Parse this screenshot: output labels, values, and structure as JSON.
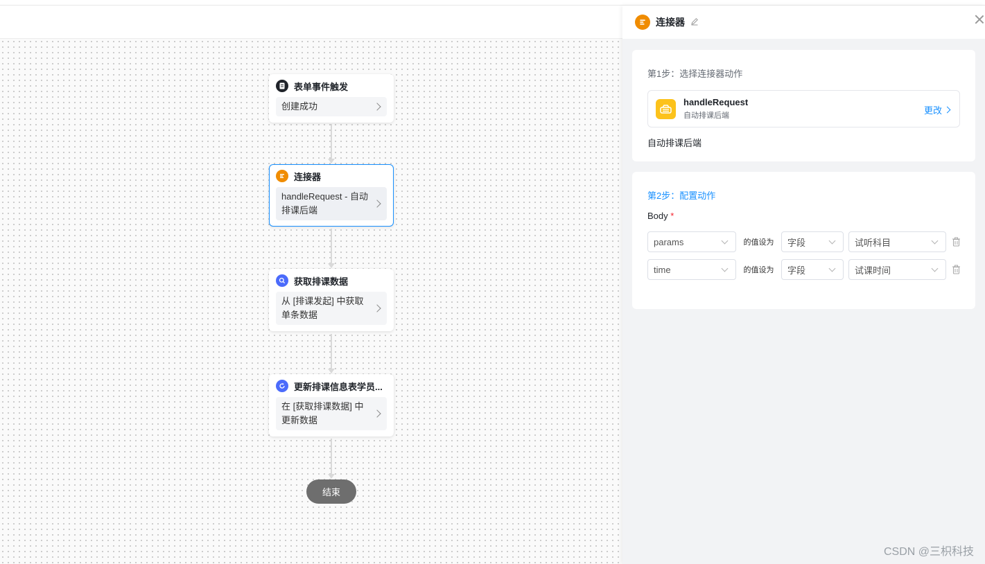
{
  "colors": {
    "accent": "#1890ff",
    "connector_orange": "#f08c00",
    "action_yellow": "#fcc21b",
    "node_blue": "#4b6bfb",
    "end_gray": "#6e6e6e"
  },
  "flow": {
    "nodes": [
      {
        "title": "表单事件触发",
        "body": "创建成功",
        "icon": "form-icon",
        "icon_color": "#1f2329"
      },
      {
        "title": "连接器",
        "body": "handleRequest - 自动排课后端",
        "icon": "connector-icon",
        "icon_color": "#f08c00"
      },
      {
        "title": "获取排课数据",
        "body": "从 [排课发起] 中获取单条数据",
        "icon": "search-icon",
        "icon_color": "#4b6bfb"
      },
      {
        "title": "更新排课信息表学员...",
        "body": "在 [获取排课数据] 中更新数据",
        "icon": "refresh-icon",
        "icon_color": "#4b6bfb"
      }
    ],
    "end_label": "结束"
  },
  "panel": {
    "title": "连接器",
    "step1": {
      "label": "第1步：选择连接器动作",
      "action_name": "handleRequest",
      "action_desc": "自动排课后端",
      "change_label": "更改",
      "description": "自动排课后端"
    },
    "step2": {
      "label": "第2步：配置动作",
      "body_label": "Body",
      "required_mark": "*",
      "rows": [
        {
          "param": "params",
          "conj": "的值设为",
          "type": "字段",
          "value": "试听科目"
        },
        {
          "param": "time",
          "conj": "的值设为",
          "type": "字段",
          "value": "试课时间"
        }
      ]
    }
  },
  "watermark": "CSDN @三枳科技"
}
